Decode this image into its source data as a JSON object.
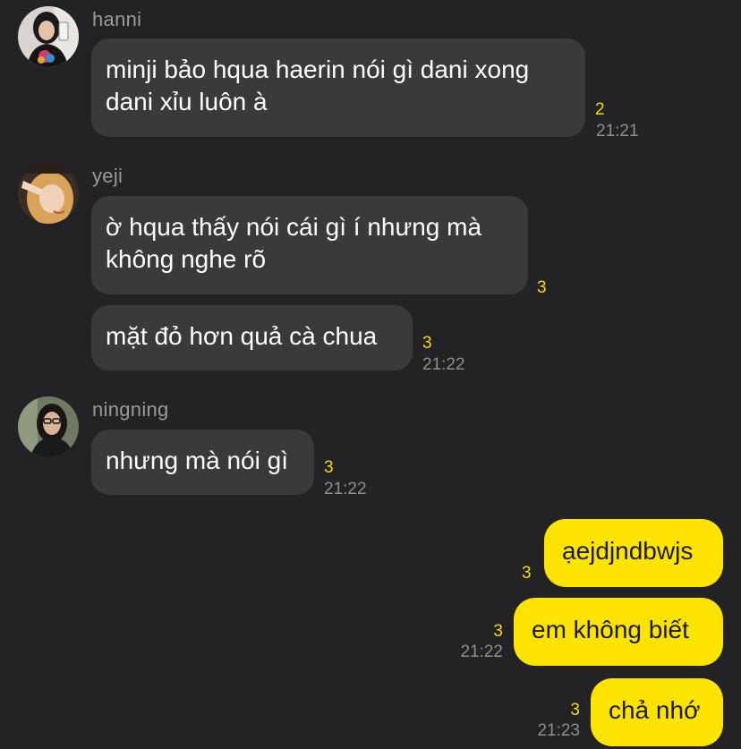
{
  "colors": {
    "background": "#232325",
    "incoming_bubble": "#3a3a3d",
    "outgoing_bubble": "#fde300",
    "unread_count": "#f5d90a",
    "timestamp": "#8e8e93"
  },
  "messages": {
    "hanni": {
      "sender": "hanni",
      "avatar_icon": "user-avatar-photo",
      "text_line1": "minji bảo hqua haerin nói gì dani xong",
      "text_line2": "dani xỉu luôn à",
      "unread": "2",
      "time": "21:21"
    },
    "yeji": {
      "sender": "yeji",
      "avatar_icon": "user-avatar-photo",
      "msg1_line1": "ờ hqua thấy nói cái gì í nhưng mà",
      "msg1_line2": "không nghe rõ",
      "msg1_unread": "3",
      "msg2": "mặt đỏ hơn quả cà chua",
      "msg2_unread": "3",
      "time": "21:22"
    },
    "ningning": {
      "sender": "ningning",
      "avatar_icon": "user-avatar-photo",
      "text": "nhưng mà nói gì",
      "unread": "3",
      "time": "21:22"
    },
    "me": {
      "msg1": "ạejdjndbwjs",
      "msg1_unread": "3",
      "msg2": "em không biết",
      "msg2_unread": "3",
      "msg2_time": "21:22",
      "msg3": "chả nhớ",
      "msg3_unread": "3",
      "msg3_time": "21:23"
    }
  }
}
